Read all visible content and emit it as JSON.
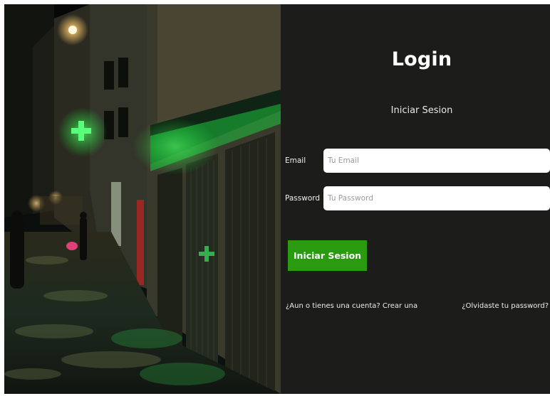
{
  "photo": {
    "description_icon": "night-street-pharmacy-photo"
  },
  "login": {
    "title": "Login",
    "subtitle": "Iniciar Sesion",
    "email": {
      "label": "Email",
      "placeholder": "Tu Email",
      "value": ""
    },
    "password": {
      "label": "Password",
      "placeholder": "Tu Password",
      "value": ""
    },
    "submit_label": "Iniciar Sesion",
    "signup_text": "¿Aun o tienes una cuenta? Crear una",
    "forgot_text": "¿Olvidaste tu password?"
  },
  "colors": {
    "panel_bg": "#1c1c1b",
    "accent_green": "#2a9a11",
    "neon_green": "#35ff5a"
  }
}
